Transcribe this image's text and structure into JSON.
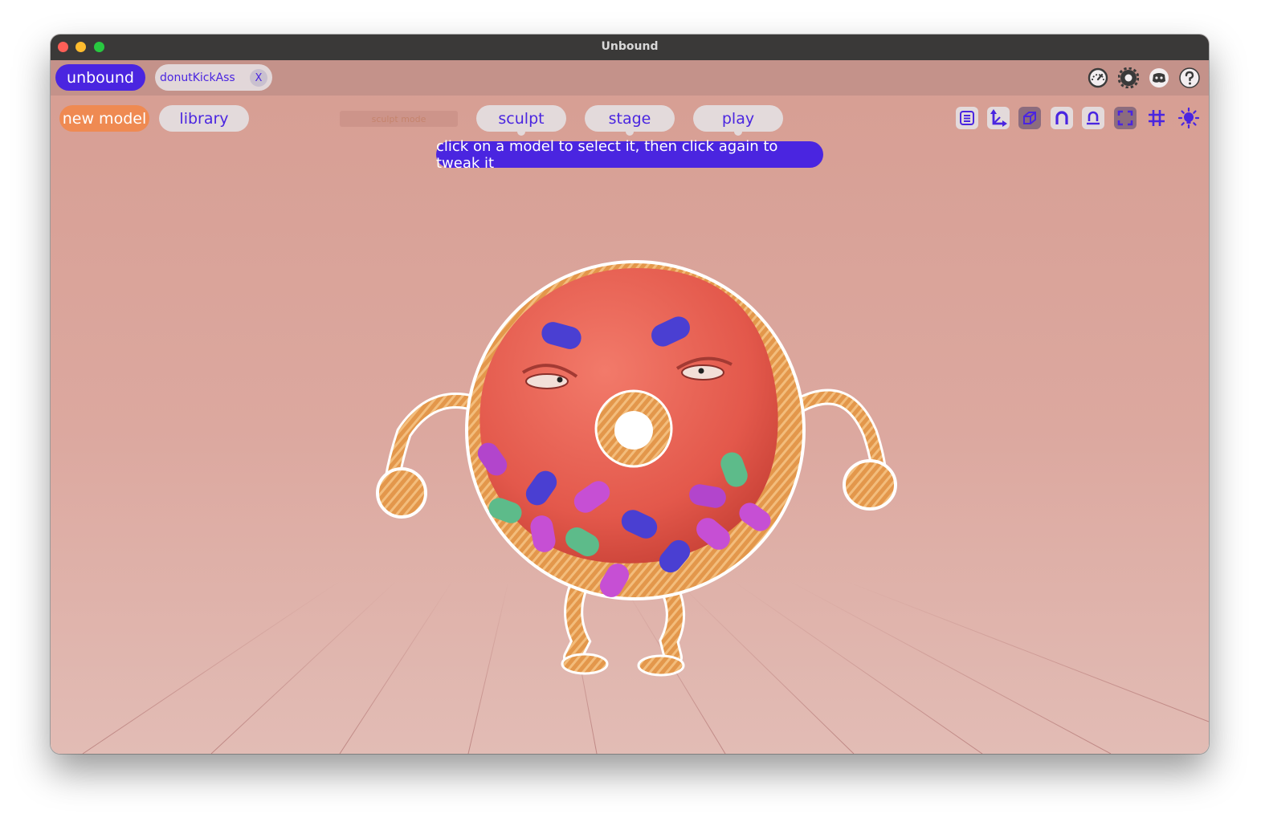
{
  "window": {
    "title": "Unbound"
  },
  "topbar": {
    "brand_label": "unbound",
    "file_tab": {
      "name": "donutKickAss",
      "close_label": "X"
    },
    "icons": [
      "performance-gauge-icon",
      "settings-gear-icon",
      "discord-icon",
      "help-icon"
    ]
  },
  "toolbar": {
    "new_model_label": "new model",
    "library_label": "library",
    "sculpt_mode_label": "sculpt mode",
    "modes": [
      "sculpt",
      "stage",
      "play"
    ],
    "right_icons": [
      "list-icon",
      "axes-icon",
      "cube-icon",
      "magnet-icon",
      "mirror-icon",
      "frame-icon",
      "grid-icon",
      "light-icon"
    ]
  },
  "hint": {
    "text": "click on a model to select it, then click again to tweak it"
  },
  "colors": {
    "accent": "#4a25e0",
    "orange": "#ef8a52",
    "background": "#dca89f"
  }
}
